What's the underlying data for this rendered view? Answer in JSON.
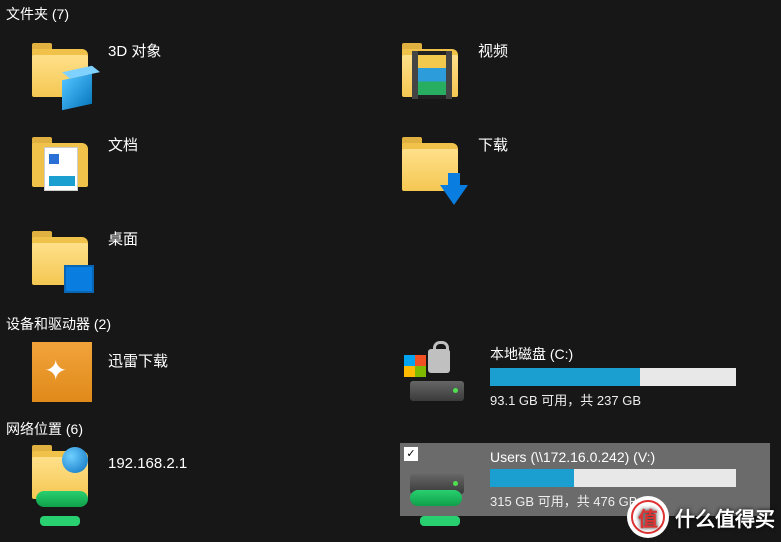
{
  "sections": {
    "folders": {
      "title": "文件夹 (7)"
    },
    "devices": {
      "title": "设备和驱动器 (2)"
    },
    "network": {
      "title": "网络位置 (6)"
    }
  },
  "folders": {
    "objects3d": "3D 对象",
    "videos": "视频",
    "documents": "文档",
    "downloads": "下载",
    "desktop": "桌面"
  },
  "devices": {
    "xunlei": "迅雷下载",
    "cDrive": {
      "title": "本地磁盘 (C:)",
      "sub": "93.1 GB 可用，共 237 GB",
      "usedPct": 61
    }
  },
  "network": {
    "loc1": "192.168.2.1",
    "vDrive": {
      "title": "Users (\\\\172.16.0.242) (V:)",
      "sub": "315 GB 可用，共 476 GB",
      "usedPct": 34
    }
  },
  "watermark": {
    "badge": "值",
    "text": "什么值得买"
  }
}
